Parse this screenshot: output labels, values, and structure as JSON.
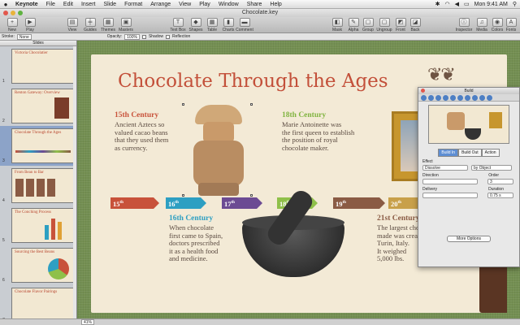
{
  "menubar": {
    "items": [
      "Keynote",
      "File",
      "Edit",
      "Insert",
      "Slide",
      "Format",
      "Arrange",
      "View",
      "Play",
      "Window",
      "Share",
      "Help"
    ],
    "clock": "Mon 9:41 AM"
  },
  "window": {
    "title": "Chocolate.key"
  },
  "toolbar": {
    "new": "New",
    "play": "Play",
    "view": "View",
    "guides": "Guides",
    "themes": "Themes",
    "masters": "Masters",
    "textbox": "Text Box",
    "shapes": "Shapes",
    "table": "Table",
    "charts": "Charts",
    "comment": "Comment",
    "mask": "Mask",
    "alpha": "Alpha",
    "group": "Group",
    "ungroup": "Ungroup",
    "front": "Front",
    "back": "Back",
    "inspector": "Inspector",
    "media": "Media",
    "colors": "Colors",
    "fonts": "Fonts"
  },
  "formatbar": {
    "stroke_label": "Stroke:",
    "stroke_value": "None",
    "opacity_label": "Opacity:",
    "opacity_value": "100%",
    "shadow": "Shadow",
    "reflection": "Reflection"
  },
  "navigator": {
    "header": "Slides",
    "slides": [
      {
        "num": "1",
        "title": "Victoria Chocolatier"
      },
      {
        "num": "2",
        "title": "Renton Gateway: Overview"
      },
      {
        "num": "3",
        "title": "Chocolate Through the Ages"
      },
      {
        "num": "4",
        "title": "From Bean to Bar"
      },
      {
        "num": "5",
        "title": "The Conching Process"
      },
      {
        "num": "6",
        "title": "Sourcing the Best Beans"
      },
      {
        "num": "7",
        "title": "Chocolate Flavor Pairings"
      }
    ]
  },
  "slide": {
    "title": "Chocolate Through the Ages",
    "c15": {
      "heading": "15th Century",
      "lines": [
        "Ancient Aztecs so",
        "valued cacao beans",
        "that they used them",
        "as currency."
      ]
    },
    "c18": {
      "heading": "18th Century",
      "lines": [
        "Marie Antoinette was",
        "the first queen to establish",
        "the position of royal",
        "chocolate maker."
      ]
    },
    "c16": {
      "heading": "16th Century",
      "lines": [
        "When chocolate",
        "first came to Spain,",
        "doctors prescribed",
        "it as a health food",
        "and medicine."
      ]
    },
    "c21": {
      "heading": "21st Century",
      "lines": [
        "The largest cho",
        "made was creat",
        "Turin, Italy.",
        "It weighed",
        "5,000 lbs."
      ]
    },
    "timeline": [
      {
        "num": "15",
        "suffix": "th",
        "color": "#c8523a"
      },
      {
        "num": "16",
        "suffix": "th",
        "color": "#2d9fc2"
      },
      {
        "num": "17",
        "suffix": "th",
        "color": "#6c4b93"
      },
      {
        "num": "18",
        "suffix": "th",
        "color": "#8fc04a"
      },
      {
        "num": "19",
        "suffix": "th",
        "color": "#8a5b44"
      },
      {
        "num": "20",
        "suffix": "th",
        "color": "#c8a04a"
      }
    ]
  },
  "inspector": {
    "title": "Build",
    "tabs": [
      "Build In",
      "Build Out",
      "Action"
    ],
    "effect_label": "Effect",
    "effect_value": "Dissolve",
    "by_value": "by Object",
    "direction_label": "Direction",
    "order_label": "Order",
    "order_value": "3",
    "delivery_label": "Delivery",
    "duration_label": "Duration",
    "duration_value": "0.75 s",
    "more_options": "More Options"
  },
  "statusbar": {
    "zoom": "41%"
  }
}
